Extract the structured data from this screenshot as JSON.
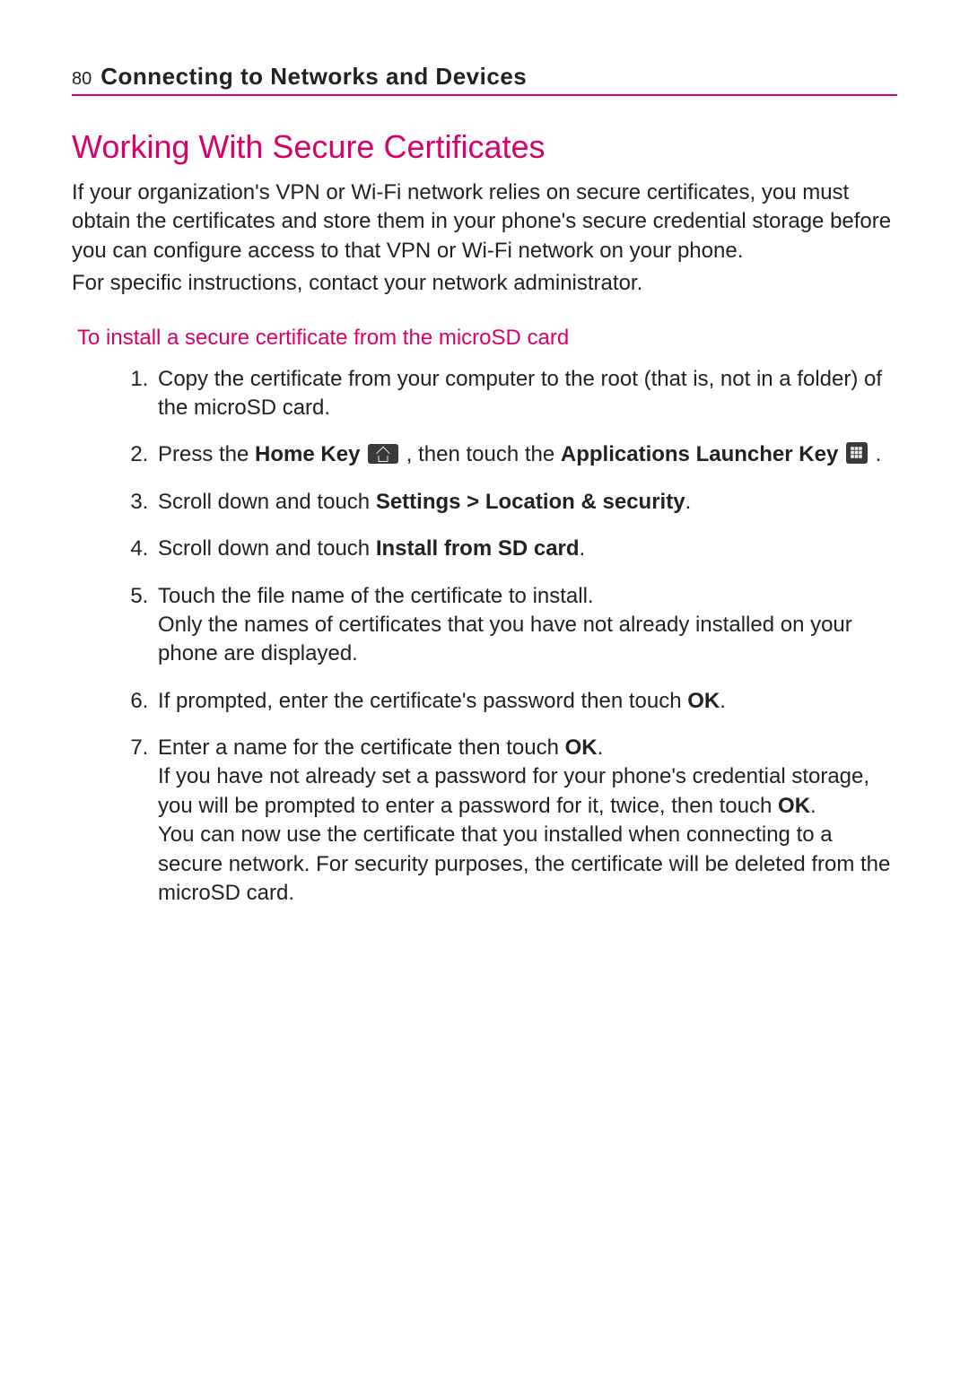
{
  "header": {
    "page_number": "80",
    "chapter_title": "Connecting to Networks and Devices"
  },
  "title": "Working With Secure Certificates",
  "intro_p1": "If your organization's VPN or Wi-Fi network relies on secure certificates, you must obtain the certificates and store them in your phone's secure credential storage before you can configure access to that VPN or Wi-Fi network on your phone.",
  "intro_p2": "For specific instructions, contact your network administrator.",
  "subheading": "To install a secure certificate from the microSD card",
  "steps": {
    "s1": "Copy the certificate from your computer to the root (that is, not in a folder) of the microSD card.",
    "s2_a": "Press the ",
    "s2_home_key": "Home Key",
    "s2_b": " , then touch the ",
    "s2_apps_key": "Applications Launcher Key",
    "s2_c": " .",
    "s3_a": "Scroll down and touch ",
    "s3_b": "Settings > Location & security",
    "s3_c": ".",
    "s4_a": "Scroll down and touch ",
    "s4_b": "Install from SD card",
    "s4_c": ".",
    "s5_a": "Touch the file name of the certificate to install.",
    "s5_b": "Only the names of certificates that you have not already installed on your phone are displayed.",
    "s6_a": "If prompted, enter the certificate's password then touch ",
    "s6_b": "OK",
    "s6_c": ".",
    "s7_a": "Enter a name for the certificate then touch ",
    "s7_b": "OK",
    "s7_c": ".",
    "s7_d": "If you have not already set a password for your phone's credential storage, you will be prompted to enter a password for it, twice, then touch ",
    "s7_e": "OK",
    "s7_f": ".",
    "s7_g": "You can now use the certificate that you installed when connecting to a secure network. For security purposes, the certificate will be deleted from the microSD card."
  }
}
